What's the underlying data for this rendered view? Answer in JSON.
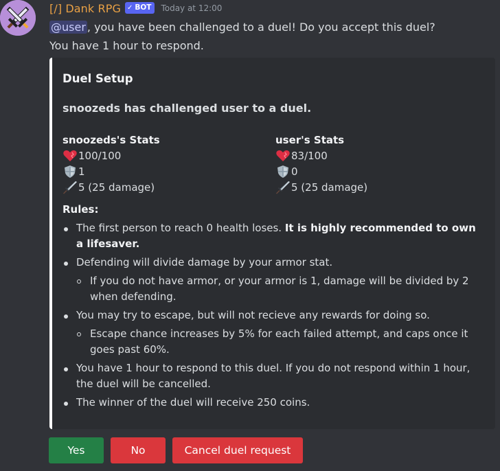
{
  "message": {
    "author": "[/] Dank RPG",
    "bot_badge": "BOT",
    "timestamp": "Today at 12:00",
    "mention": "@user",
    "line1_rest": ", you have been challenged to a duel! Do you accept this duel?",
    "line2": "You have 1 hour to respond."
  },
  "embed": {
    "accent_color": "#ffffff",
    "title": "Duel Setup",
    "description": "snoozeds has challenged user to a duel.",
    "fields": [
      {
        "name": "snoozeds's Stats",
        "health": "100/100",
        "armor": "1",
        "attack": "5 (25 damage)"
      },
      {
        "name": "user's Stats",
        "health": "83/100",
        "armor": "0",
        "attack": "5 (25 damage)"
      }
    ],
    "rules_title": "Rules:",
    "rules": [
      {
        "text": "The first person to reach 0 health loses. ",
        "bold": "It is highly recommended to own a lifesaver."
      },
      {
        "text": "Defending will divide damage by your armor stat."
      },
      {
        "text": "If you do not have armor, or your armor is 1, damage will be divided by 2 when defending."
      },
      {
        "text": "You may try to escape, but will not recieve any rewards for doing so."
      },
      {
        "text": "Escape chance increases by 5% for each failed attempt, and caps once it goes past 60%."
      },
      {
        "text": "You have 1 hour to respond to this duel. If you do not respond within 1 hour, the duel will be cancelled."
      },
      {
        "text": "The winner of the duel will receive 250 coins."
      }
    ]
  },
  "buttons": {
    "yes": "Yes",
    "no": "No",
    "cancel": "Cancel duel request"
  },
  "colors": {
    "background": "#313338",
    "embed_bg": "#2b2d31",
    "username": "#e8a045",
    "success": "#248046",
    "danger": "#da373c",
    "brand": "#5865f2"
  }
}
